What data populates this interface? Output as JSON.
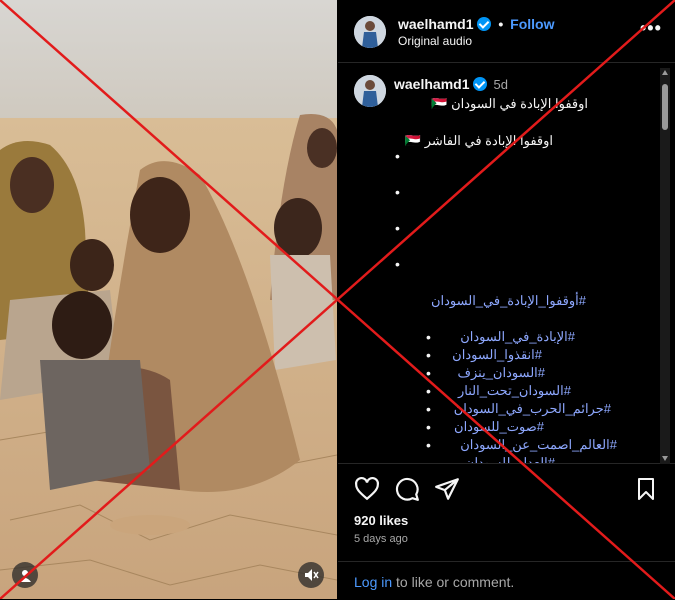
{
  "header": {
    "username": "waelhamd1",
    "separator": "•",
    "follow_label": "Follow",
    "audio_label": "Original audio",
    "more_icon": "more-options-icon"
  },
  "caption": {
    "username": "waelhamd1",
    "age": "5d",
    "line1": "اوقفوا الإبادة في السودان 🇸🇩",
    "line2": "اوقفوا الإبادة في الفاشر 🇸🇩",
    "bullets": [
      "•",
      "•",
      "•",
      "•"
    ],
    "main_tag": "#أوقفوا_الإبادة_في_السودان",
    "tags": [
      "#الإبادة_في_السودان",
      "#انقذوا_السودان",
      "#السودان_ينزف",
      "#السودان_تحت_النار",
      "#جرائم_الحرب_في_السودان",
      "#صوت_للسودان",
      "#العالم_اصمت_عن_السودان",
      "#العدل_للسودان"
    ],
    "tag_bullets": [
      "•",
      "•",
      "•",
      "•",
      "•",
      "•",
      "•"
    ]
  },
  "actions": {
    "like_icon": "heart-icon",
    "comment_icon": "comment-icon",
    "share_icon": "share-icon",
    "save_icon": "bookmark-icon"
  },
  "likes": "920 likes",
  "timestamp": "5 days ago",
  "footer": {
    "login_link": "Log in",
    "login_text": " to like or comment."
  },
  "media": {
    "user_icon": "user-tag-icon",
    "mute_icon": "muted-speaker-icon"
  },
  "colors": {
    "background": "#000000",
    "link": "#4c9aff",
    "hashtag": "#8ea8ff",
    "verified": "#0095f6",
    "overlay_cross": "#e21b1b"
  }
}
